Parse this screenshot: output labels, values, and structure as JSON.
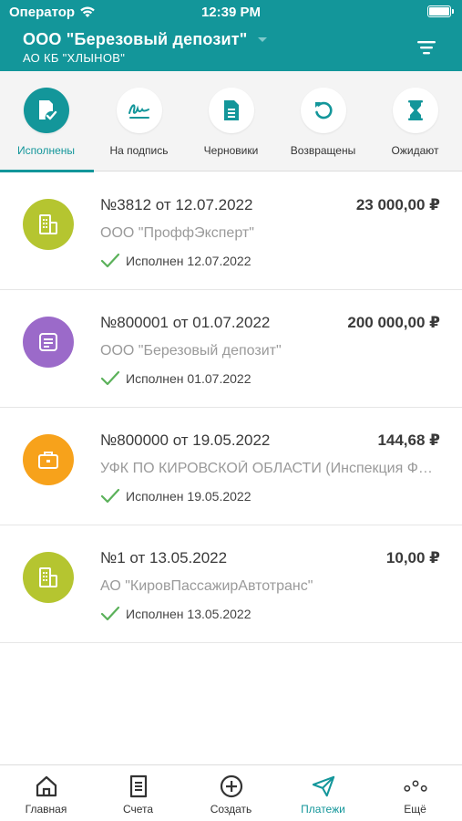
{
  "status_bar": {
    "carrier": "Оператор",
    "time": "12:39 PM"
  },
  "header": {
    "org_name": "ООО \"Березовый депозит\"",
    "bank": "АО КБ \"ХЛЫНОВ\"",
    "accent_color": "#13969A"
  },
  "tabs": [
    {
      "label": "Исполнены",
      "icon": "document-check-icon",
      "active": true
    },
    {
      "label": "На подпись",
      "icon": "signature-icon",
      "active": false
    },
    {
      "label": "Черновики",
      "icon": "document-icon",
      "active": false
    },
    {
      "label": "Возвращены",
      "icon": "undo-arrow-icon",
      "active": false
    },
    {
      "label": "Ожидают",
      "icon": "hourglass-icon",
      "active": false
    }
  ],
  "payments": [
    {
      "title": "№3812 от 12.07.2022",
      "amount": "23 000,00 ₽",
      "party": "ООО \"ПроффЭксперт\"",
      "status": "Исполнен 12.07.2022",
      "icon": "buildings-icon",
      "color": "#B5C530"
    },
    {
      "title": "№800001 от 01.07.2022",
      "amount": "200 000,00 ₽",
      "party": "ООО \"Березовый депозит\"",
      "status": "Исполнен 01.07.2022",
      "icon": "document-list-icon",
      "color": "#9B6AC9"
    },
    {
      "title": "№800000 от 19.05.2022",
      "amount": "144,68 ₽",
      "party": "УФК ПО КИРОВСКОЙ ОБЛАСТИ (Инспекция ФНС России по г. Кирову)",
      "status": "Исполнен 19.05.2022",
      "icon": "briefcase-icon",
      "color": "#F7A21B"
    },
    {
      "title": "№1 от 13.05.2022",
      "amount": "10,00 ₽",
      "party": "АО \"КировПассажирАвтотранс\"",
      "status": "Исполнен 13.05.2022",
      "icon": "buildings-icon",
      "color": "#B5C530"
    }
  ],
  "tabbar": [
    {
      "label": "Главная",
      "icon": "home-icon",
      "active": false
    },
    {
      "label": "Счета",
      "icon": "receipt-icon",
      "active": false
    },
    {
      "label": "Создать",
      "icon": "plus-circle-icon",
      "active": false
    },
    {
      "label": "Платежи",
      "icon": "paper-plane-icon",
      "active": true
    },
    {
      "label": "Ещё",
      "icon": "more-dots-icon",
      "active": false
    }
  ]
}
